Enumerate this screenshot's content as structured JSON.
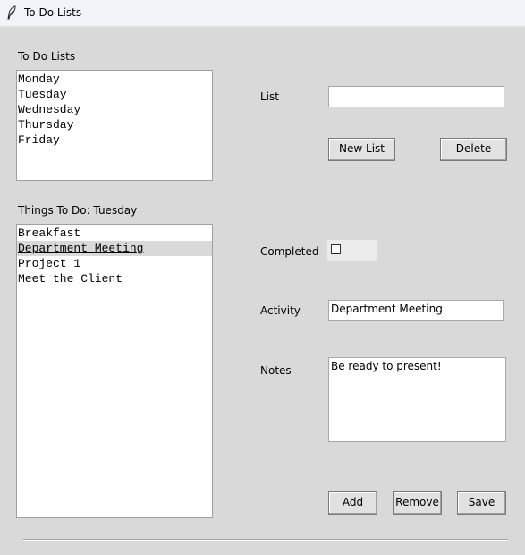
{
  "window": {
    "title": "To Do Lists"
  },
  "lists_section": {
    "label": "To Do Lists",
    "items": [
      "Monday",
      "Tuesday",
      "Wednesday",
      "Thursday",
      "Friday"
    ]
  },
  "things_section": {
    "label": "Things To Do: Tuesday",
    "items": [
      "Breakfast",
      "Department Meeting",
      "Project 1",
      "Meet the Client"
    ],
    "selected_item": "Department Meeting"
  },
  "form": {
    "list_label": "List",
    "list_value": "",
    "new_list_button": "New List",
    "delete_button": "Delete",
    "completed_label": "Completed",
    "completed_checked": false,
    "activity_label": "Activity",
    "activity_value": "Department Meeting",
    "notes_label": "Notes",
    "notes_value": "Be ready to present!",
    "add_button": "Add",
    "remove_button": "Remove",
    "save_button": "Save"
  }
}
